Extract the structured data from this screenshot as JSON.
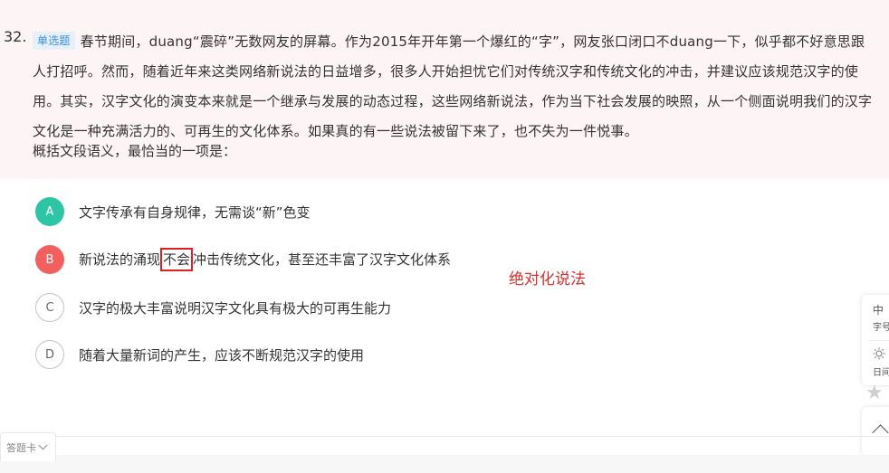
{
  "question": {
    "number": "32.",
    "tag": "单选题",
    "text": "春节期间，duang“震碎”无数网友的屏幕。作为2015年开年第一个爆红的“字”，网友张口闭口不duang一下，似乎都不好意思跟人打招呼。然而，随着近年来这类网络新说法的日益增多，很多人开始担忧它们对传统汉字和传统文化的冲击，并建议应该规范汉字的使用。其实，汉字文化的演变本来就是一个继承与发展的动态过程，这些网络新说法，作为当下社会发展的映照，从一个侧面说明我们的汉字文化是一种充满活力的、可再生的文化体系。如果真的有一些说法被留下来了，也不失为一件悦事。",
    "prompt": "概括文段语义，最恰当的一项是："
  },
  "options": [
    {
      "letter": "A",
      "text": "文字传承有自身规律，无需谈“新”色变"
    },
    {
      "letter": "B",
      "text_before": "新说法的涌现",
      "text_highlight": "不会",
      "text_after": "冲击传统文化，甚至还丰富了汉字文化体系"
    },
    {
      "letter": "C",
      "text": "汉字的极大丰富说明汉字文化具有极大的可再生能力"
    },
    {
      "letter": "D",
      "text": "随着大量新词的产生，应该不断规范汉字的使用"
    }
  ],
  "annotation": "绝对化说法",
  "tools": {
    "font_size_value": "中",
    "font_size_label": "字号",
    "day_mode_label": "日间",
    "favorite_icon": "star-icon",
    "top_icon": "chevron-up-icon"
  },
  "answer_card_label": "答题卡",
  "colors": {
    "question_bg": "#fdf5f5",
    "option_a": "#2ec5a4",
    "option_b": "#f15f5f",
    "tag_text": "#3a8ee6",
    "annotation": "#d9302c"
  }
}
